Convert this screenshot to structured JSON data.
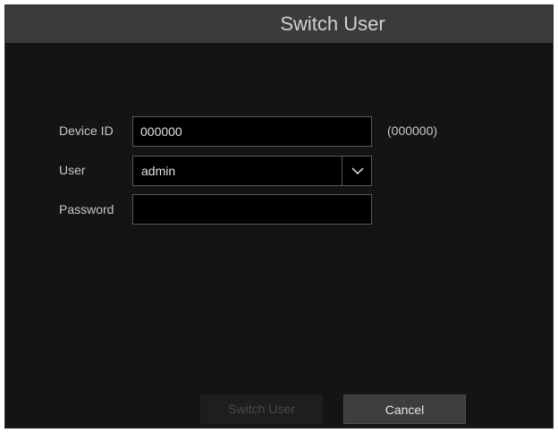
{
  "dialog": {
    "title": "Switch User"
  },
  "form": {
    "device_id_label": "Device ID",
    "device_id_value": "000000",
    "device_id_hint": "(000000)",
    "user_label": "User",
    "user_value": "admin",
    "password_label": "Password",
    "password_value": ""
  },
  "buttons": {
    "switch_user": "Switch User",
    "cancel": "Cancel"
  },
  "colors": {
    "dialog_bg": "#141414",
    "titlebar_bg": "#3b3b3b",
    "field_border": "#5a5a5a",
    "disabled_text": "#4a4a4a"
  },
  "icons": {
    "user_dropdown": "chevron-down-icon"
  }
}
